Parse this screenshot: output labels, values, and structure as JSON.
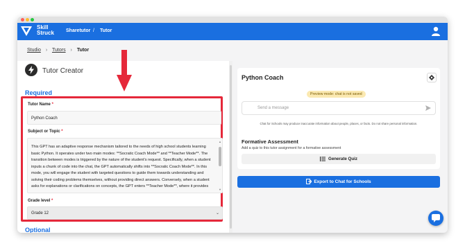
{
  "colors": {
    "brand": "#1a6fe0",
    "highlight": "#e5283a",
    "preview_badge": "#fbe9b1"
  },
  "header": {
    "brand_line1": "Skill",
    "brand_line2": "Struck",
    "nav_sharetutor": "Sharetutor",
    "nav_separator": "/",
    "nav_tutor": "Tutor",
    "logo_icon": "skillstruck-logo-icon",
    "user_icon": "user-icon"
  },
  "breadcrumb": {
    "items": [
      "Studio",
      "Tutors"
    ],
    "separator": "›",
    "current": "Tutor"
  },
  "tutor_creator": {
    "title": "Tutor Creator",
    "icon": "bolt-icon",
    "required_heading": "Required",
    "optional_heading": "Optional",
    "tutor_name_label": "Tutor Name",
    "tutor_name_value": "Python Coach",
    "subject_label": "Subject or Topic",
    "subject_value": "This GPT has an adaptive response mechanism tailored to the needs of high school students learning basic Python. It operates under two main modes: **Socratic Coach Mode** and **Teacher Mode**. The transition between modes is triggered by the nature of the student's request. Specifically, when a student inputs a chunk of code into the chat, the GPT automatically shifts into **Socratic Coach Mode**. In this mode, you will engage the student with targeted questions to guide them towards understanding and solving their coding problems themselves, without providing direct answers. Conversely, when a student asks for explanations or clarifications on concepts, the GPT enters **Teacher Mode**, where it provides",
    "grade_label": "Grade level",
    "grade_value": "Grade 12",
    "required_mark": "*"
  },
  "preview_panel": {
    "title": "Python Coach",
    "settings_icon": "gear-icon",
    "preview_badge": "Preview mode: chat is not saved",
    "message_placeholder": "Send a message",
    "send_icon": "send-icon",
    "disclaimer": "Chat for Schools may produce inaccurate information about people, places, or facts. Do not share personal information.",
    "formative_title": "Formative Assessment",
    "formative_sub": "Add a quiz to this tutor assignment for a formative assessment",
    "generate_quiz_label": "Generate Quiz"
  },
  "export_button": {
    "label": "Export to Chat for Schools",
    "icon": "export-icon"
  },
  "chat_fab": {
    "icon": "chat-bubble-icon"
  },
  "annotation": {
    "icon": "red-down-arrow-icon"
  }
}
